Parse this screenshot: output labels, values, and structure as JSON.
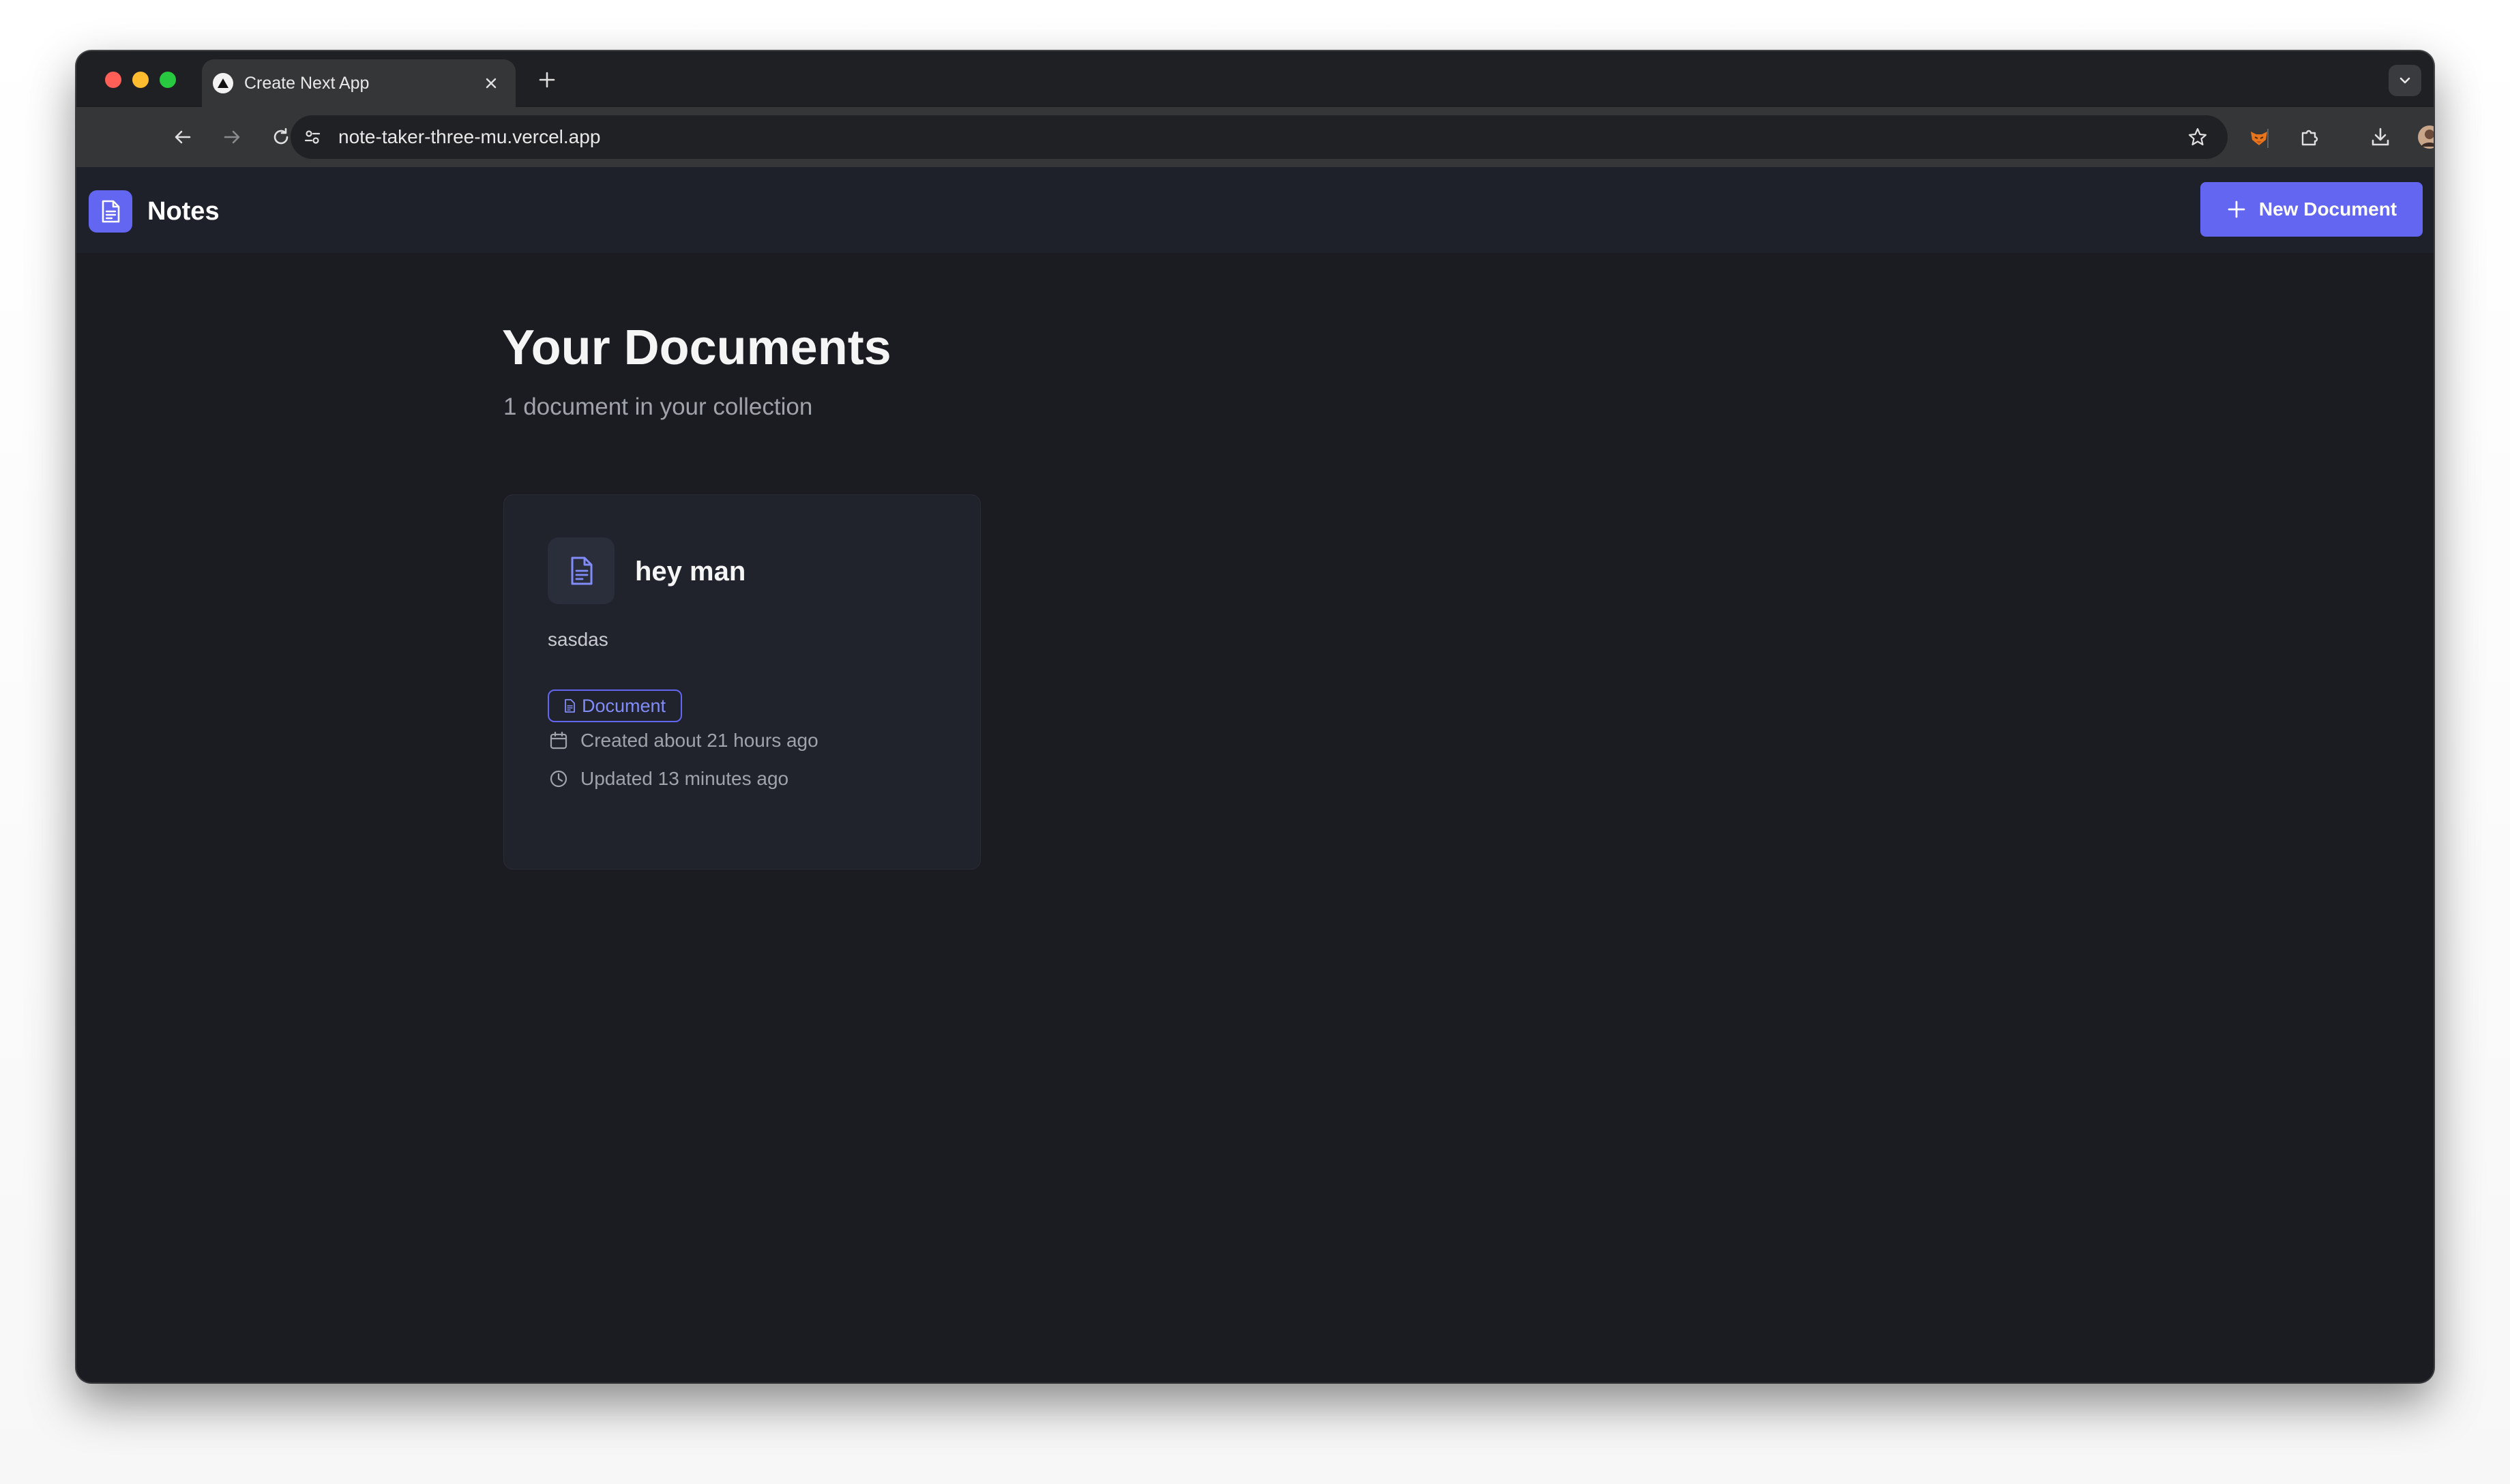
{
  "browser": {
    "tab_title": "Create Next App",
    "url": "note-taker-three-mu.vercel.app"
  },
  "header": {
    "app_name": "Notes",
    "new_document_label": "New Document"
  },
  "main": {
    "title": "Your Documents",
    "subtitle": "1 document in your collection",
    "documents": [
      {
        "title": "hey man",
        "description": "sasdas",
        "badge": "Document",
        "created": "Created about 21 hours ago",
        "updated": "Updated 13 minutes ago"
      }
    ]
  },
  "colors": {
    "accent": "#6366f1",
    "page_background": "#1a1c21",
    "card_background": "#20232b"
  },
  "icons": [
    "vercel-triangle-icon",
    "close-icon",
    "plus-icon",
    "chevron-down-icon",
    "back-arrow-icon",
    "forward-arrow-icon",
    "reload-icon",
    "home-icon",
    "site-info-icon",
    "star-icon",
    "extension-fox-icon",
    "puzzle-icon",
    "download-icon",
    "avatar",
    "kebab-menu-icon",
    "document-icon",
    "calendar-icon",
    "clock-icon"
  ]
}
